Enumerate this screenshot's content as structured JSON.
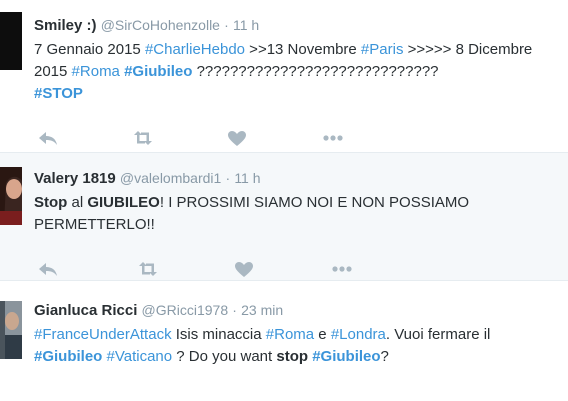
{
  "colors": {
    "link": "#3b94d9",
    "text": "#292f33",
    "meta": "#8899a6",
    "action_icon": "#aab8c2",
    "alt_background": "#f5f8fa"
  },
  "tweets": [
    {
      "fullname": "Smiley :)",
      "username": "@SirCoHohenzolle",
      "separator": "·",
      "time": "11 h",
      "line1": {
        "t1": "7 Gennaio 2015 ",
        "h1": "#CharlieHebdo",
        "t2": " >>13 Novembre ",
        "h2": "#Paris",
        "t3": " >>>>> 8 Dicembre"
      },
      "line2": {
        "t1": "2015 ",
        "h1": "#Roma",
        "h2": "#Giubileo",
        "t2": " ?????????????????????????????"
      },
      "line3": {
        "h1": "#STOP"
      },
      "actions": [
        "reply-icon",
        "retweet-icon",
        "like-icon",
        "more-icon"
      ]
    },
    {
      "fullname": "Valery 1819",
      "username": "@valelombardi1",
      "separator": "·",
      "time": "11 h",
      "line1": {
        "b1": "Stop",
        "t1": " al ",
        "b2": "GIUBILEO",
        "t2": "! I PROSSIMI SIAMO NOI E NON POSSIAMO"
      },
      "line2": {
        "t1": "PERMETTERLO!!"
      },
      "actions": [
        "reply-icon",
        "retweet-icon",
        "like-icon",
        "more-icon"
      ]
    },
    {
      "fullname": "Gianluca Ricci",
      "username": "@GRicci1978",
      "separator": "·",
      "time": "23 min",
      "line1": {
        "h1": "#FranceUnderAttack",
        "t1": " Isis  minaccia ",
        "h2": "#Roma",
        "t2": " e ",
        "h3": "#Londra",
        "t3": ". Vuoi fermare il"
      },
      "line2": {
        "h1": "#Giubileo",
        "h2": "#Vaticano",
        "t1": " ? Do you want ",
        "b1": "stop",
        "h3": "#Giubileo",
        "t2": "?"
      }
    }
  ]
}
